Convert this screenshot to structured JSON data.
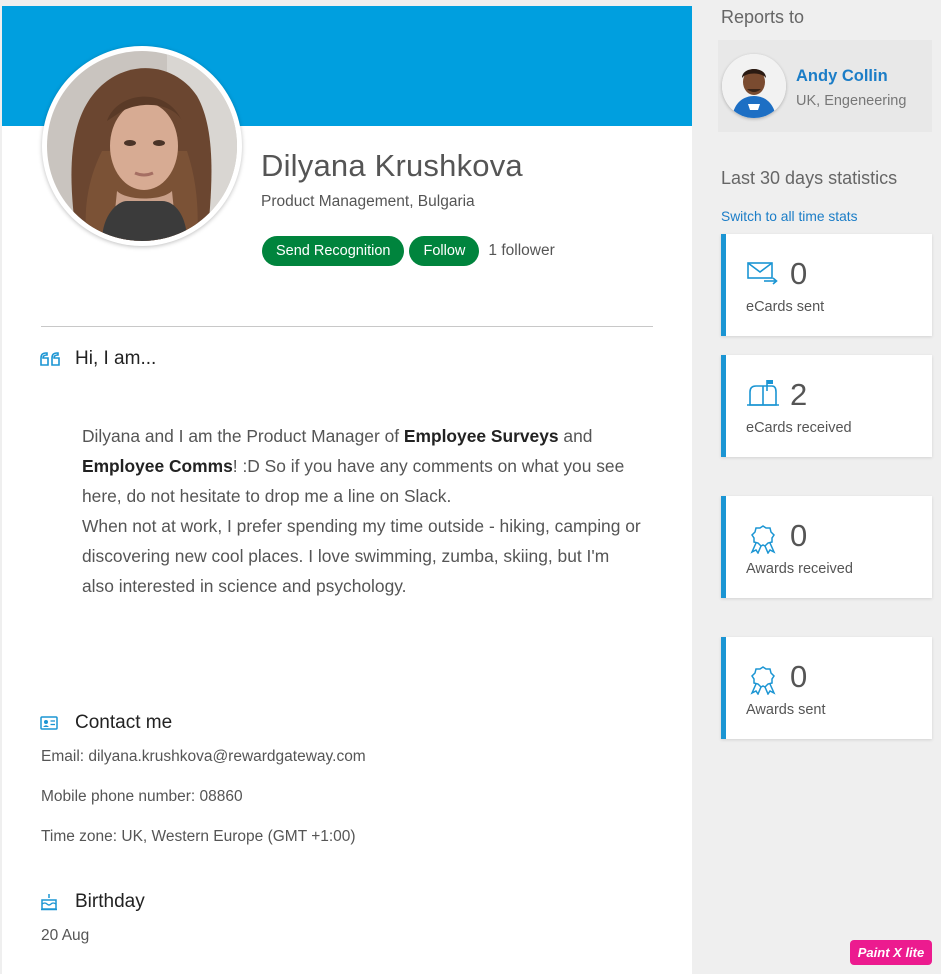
{
  "profile": {
    "name": "Dilyana Krushkova",
    "role": "Product Management, Bulgaria",
    "send_recognition_label": "Send Recognition",
    "follow_label": "Follow",
    "followers": "1 follower",
    "banner_color": "#009fdf",
    "button_color": "#00843d"
  },
  "about": {
    "title": "Hi, I am...",
    "icon": "quote-icon",
    "p1_start": "Dilyana and I am the Product Manager of ",
    "p1_bold1": "Employee Surveys",
    "p1_mid": " and ",
    "p1_bold2": "Employee Comms",
    "p1_end": "! :D So if you have any comments on what you see here, do not hesitate to drop me a line on Slack.",
    "p2": "When not at work, I prefer spending my time outside - hiking, camping or discovering new cool places. I love swimming, zumba, skiing, but I'm also interested in science and psychology."
  },
  "contact": {
    "title": "Contact me",
    "icon": "contact-card-icon",
    "email": "Email: dilyana.krushkova@rewardgateway.com",
    "mobile": "Mobile phone number: 08860",
    "timezone": "Time zone: UK, Western Europe (GMT +1:00)"
  },
  "birthday": {
    "title": "Birthday",
    "icon": "cake-icon",
    "date": "20 Aug"
  },
  "sidebar": {
    "reports_to_label": "Reports to",
    "manager_name": "Andy Collin",
    "manager_dept": "UK, Engeneering",
    "stats_title": "Last 30 days statistics",
    "switch_link": "Switch to all time stats",
    "accent_color": "#1b95d3",
    "stats": [
      {
        "value": "0",
        "label": "eCards sent",
        "icon": "ecard-sent-icon"
      },
      {
        "value": "2",
        "label": "eCards received",
        "icon": "mailbox-icon"
      },
      {
        "value": "0",
        "label": "Awards received",
        "icon": "award-ribbon-icon"
      },
      {
        "value": "0",
        "label": "Awards sent",
        "icon": "award-ribbon-icon"
      }
    ]
  },
  "watermark": "Paint X lite"
}
